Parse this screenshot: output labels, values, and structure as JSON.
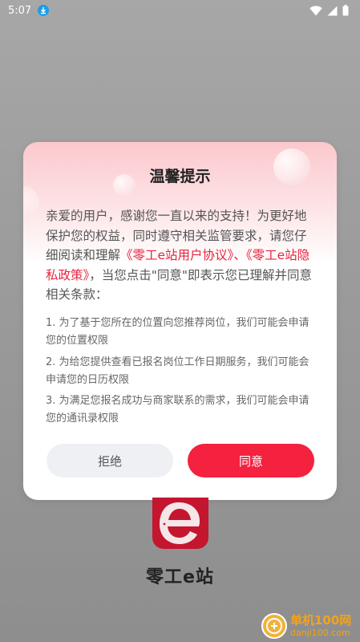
{
  "status_bar": {
    "time": "5:07"
  },
  "dialog": {
    "title": "温馨提示",
    "intro_1": "亲爱的用户，感谢您一直以来的支持！为更好地保护您的权益，同时遵守相关监管要求，请您仔细阅读和理解",
    "link_user_agreement": "《零工e站用户协议》",
    "separator": "、",
    "link_privacy": "《零工e站隐私政策》",
    "intro_2": "，当您点击\"同意\"即表示您已理解并同意相关条款：",
    "permissions": [
      "1. 为了基于您所在的位置向您推荐岗位，我们可能会申请您的位置权限",
      "2. 为给您提供查看已报名岗位工作日期服务，我们可能会申请您的日历权限",
      "3. 为满足您报名成功与商家联系的需求，我们可能会申请您的通讯录权限"
    ],
    "reject_label": "拒绝",
    "agree_label": "同意"
  },
  "app": {
    "name": "零工e站"
  },
  "watermark": {
    "brand": "单机100网",
    "url": "danji100.com"
  },
  "colors": {
    "accent": "#f4213f",
    "link": "#e8233f",
    "logo": "#c4162f"
  }
}
